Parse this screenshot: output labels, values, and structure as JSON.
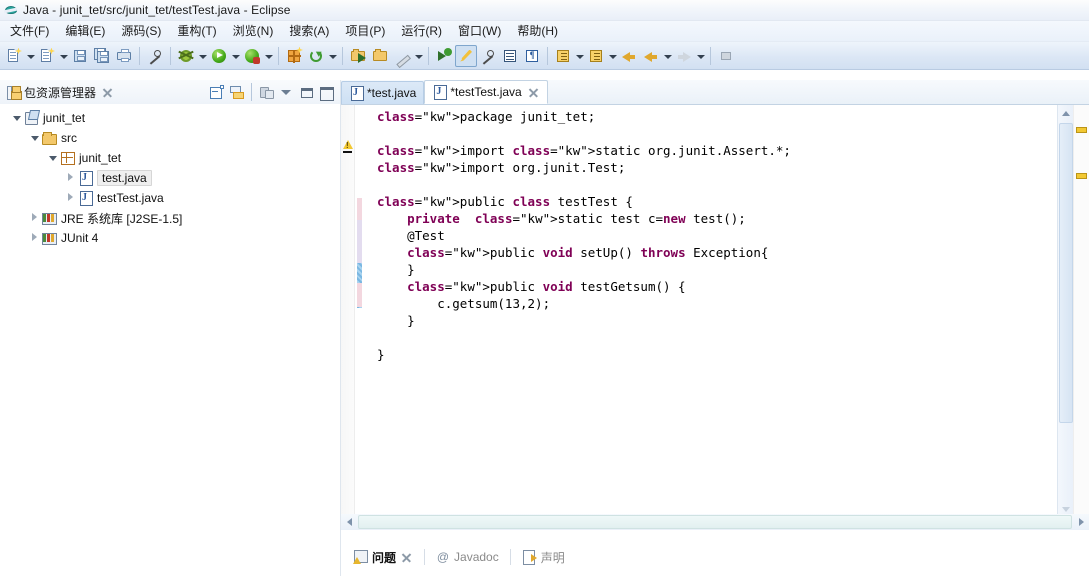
{
  "window": {
    "title": "Java - junit_tet/src/junit_tet/testTest.java - Eclipse",
    "app_icon": "eclipse-icon"
  },
  "menubar": {
    "items": [
      {
        "label": "文件(F)",
        "name": "menu-file"
      },
      {
        "label": "编辑(E)",
        "name": "menu-edit"
      },
      {
        "label": "源码(S)",
        "name": "menu-source"
      },
      {
        "label": "重构(T)",
        "name": "menu-refactor"
      },
      {
        "label": "浏览(N)",
        "name": "menu-navigate"
      },
      {
        "label": "搜索(A)",
        "name": "menu-search"
      },
      {
        "label": "项目(P)",
        "name": "menu-project"
      },
      {
        "label": "运行(R)",
        "name": "menu-run"
      },
      {
        "label": "窗口(W)",
        "name": "menu-window"
      },
      {
        "label": "帮助(H)",
        "name": "menu-help"
      }
    ]
  },
  "toolbar": {
    "icons": [
      "new-wizard-icon",
      "new-java-class-icon",
      "save-icon",
      "save-all-icon",
      "print-icon",
      "toggle-mark-occurrences-icon",
      "debug-icon",
      "run-icon",
      "run-coverage-icon",
      "new-junit-test-icon",
      "external-tools-icon",
      "open-type-icon",
      "search-icon",
      "next-annotation-icon",
      "previous-annotation-icon",
      "last-edit-location-icon",
      "back-icon",
      "forward-icon",
      "pin-editor-icon"
    ]
  },
  "package_explorer": {
    "title": "包资源管理器",
    "view_icon": "package-explorer-icon",
    "close_icon": "close-icon",
    "tools": [
      {
        "name": "collapse-all-icon"
      },
      {
        "name": "link-with-editor-icon"
      },
      {
        "name": "show-jar-icon"
      },
      {
        "name": "view-menu-icon"
      },
      {
        "name": "minimize-icon"
      },
      {
        "name": "maximize-icon"
      }
    ],
    "tree": [
      {
        "label": "junit_tet",
        "suffix": "",
        "indent": 0,
        "twist": "open",
        "icon": "java-project-icon",
        "selected": false
      },
      {
        "label": "src",
        "suffix": "",
        "indent": 1,
        "twist": "open",
        "icon": "source-folder-icon",
        "selected": false
      },
      {
        "label": "junit_tet",
        "suffix": "",
        "indent": 2,
        "twist": "open",
        "icon": "package-icon",
        "selected": false
      },
      {
        "label": "test.java",
        "suffix": "",
        "indent": 3,
        "twist": "closed",
        "icon": "java-file-icon",
        "selected": true
      },
      {
        "label": "testTest.java",
        "suffix": "",
        "indent": 3,
        "twist": "closed",
        "icon": "java-file-icon",
        "selected": false
      },
      {
        "label": "JRE 系统库",
        "suffix": "[J2SE-1.5]",
        "indent": 1,
        "twist": "closed",
        "icon": "library-icon",
        "selected": false
      },
      {
        "label": "JUnit 4",
        "suffix": "",
        "indent": 1,
        "twist": "closed",
        "icon": "library-icon",
        "selected": false
      }
    ]
  },
  "editor": {
    "tabs": [
      {
        "label": "*test.java",
        "active": false,
        "closable": false,
        "icon": "java-file-icon"
      },
      {
        "label": "*testTest.java",
        "active": true,
        "closable": true,
        "icon": "java-file-icon"
      }
    ],
    "code_lines": [
      {
        "text": "package junit_tet;",
        "indent": 0
      },
      {
        "text": "",
        "indent": 0
      },
      {
        "text": "import static org.junit.Assert.*;",
        "indent": 0
      },
      {
        "text": "import org.junit.Test;",
        "indent": 0
      },
      {
        "text": "",
        "indent": 0
      },
      {
        "text": "public class testTest {",
        "indent": 0
      },
      {
        "text": "private  static test c=new test();",
        "indent": 1
      },
      {
        "text": "@Test",
        "indent": 1
      },
      {
        "text": "public void setUp() throws Exception{",
        "indent": 1
      },
      {
        "text": "}",
        "indent": 1
      },
      {
        "text": "public void testGetsum() {",
        "indent": 1
      },
      {
        "text": "c.getsum(13,2);",
        "indent": 2
      },
      {
        "text": "}",
        "indent": 1
      },
      {
        "text": "",
        "indent": 0
      },
      {
        "text": "}",
        "indent": 0
      }
    ],
    "keywords": [
      "package",
      "import",
      "static",
      "public",
      "class",
      "private",
      "void",
      "throws",
      "new"
    ],
    "annotations": {
      "warning_icon": "warning-icon",
      "fold_icon": "collapse-fold-icon",
      "overview_markers": 2
    },
    "scrollbars": {
      "vertical": "vertical-scrollbar",
      "horizontal": "horizontal-scrollbar"
    }
  },
  "bottom_view": {
    "tabs": [
      {
        "label": "问题",
        "active": true,
        "icon": "problems-icon",
        "closable": true
      },
      {
        "label": "Javadoc",
        "active": false,
        "icon": "javadoc-icon",
        "closable": false
      },
      {
        "label": "声明",
        "active": false,
        "icon": "declaration-icon",
        "closable": false
      }
    ]
  },
  "colors": {
    "keyword": "#7f0055",
    "chrome": "#d2e0f2",
    "current_line": "#eaf2fc",
    "warning": "#f2c832",
    "link_text": "#8a8a8a"
  }
}
